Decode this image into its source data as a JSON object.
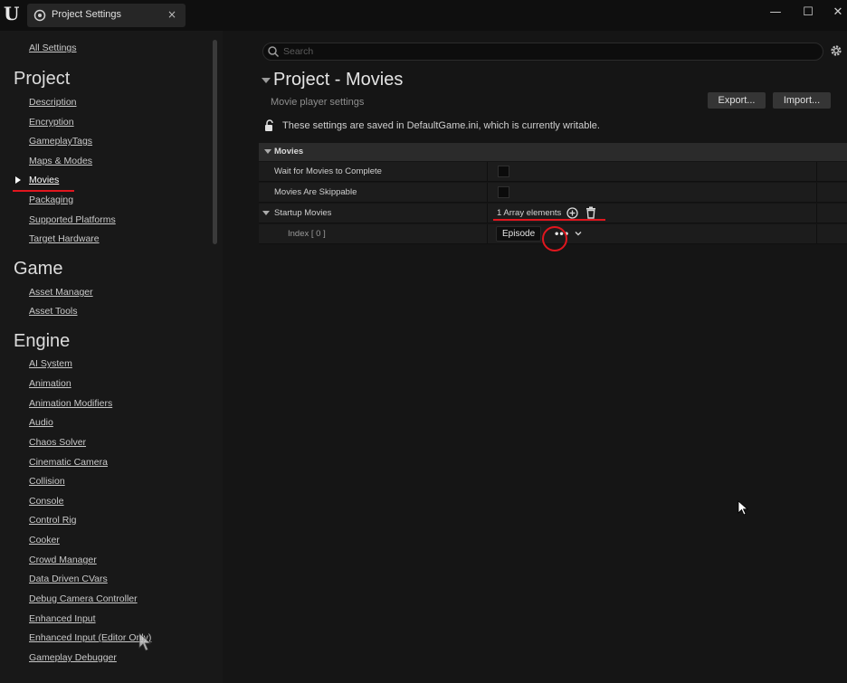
{
  "window": {
    "tab_title": "Project Settings",
    "tab_close": "×",
    "minimize": "—",
    "maximize": "☐",
    "close": "✕"
  },
  "sidebar": {
    "all_settings": "All Settings",
    "sections": [
      {
        "title": "Project",
        "items": [
          "Description",
          "Encryption",
          "GameplayTags",
          "Maps & Modes",
          "Movies",
          "Packaging",
          "Supported Platforms",
          "Target Hardware"
        ]
      },
      {
        "title": "Game",
        "items": [
          "Asset Manager",
          "Asset Tools"
        ]
      },
      {
        "title": "Engine",
        "items": [
          "AI System",
          "Animation",
          "Animation Modifiers",
          "Audio",
          "Chaos Solver",
          "Cinematic Camera",
          "Collision",
          "Console",
          "Control Rig",
          "Cooker",
          "Crowd Manager",
          "Data Driven CVars",
          "Debug Camera Controller",
          "Enhanced Input",
          "Enhanced Input (Editor Only)",
          "Gameplay Debugger"
        ]
      }
    ],
    "active_item": "Movies"
  },
  "main": {
    "search_placeholder": "Search",
    "title": "Project - Movies",
    "subtitle": "Movie player settings",
    "export_label": "Export...",
    "import_label": "Import...",
    "saved_note": "These settings are saved in DefaultGame.ini, which is currently writable.",
    "category": "Movies",
    "rows": {
      "wait": "Wait for Movies to Complete",
      "skippable": "Movies Are Skippable",
      "startup": "Startup Movies",
      "array_count": "1 Array elements",
      "index_label": "Index [ 0 ]",
      "index_value": "Episode",
      "dots": "•••"
    }
  },
  "colors": {
    "annotation_red": "#e0161e",
    "background": "#151515",
    "sidebar_bg": "#181818"
  }
}
